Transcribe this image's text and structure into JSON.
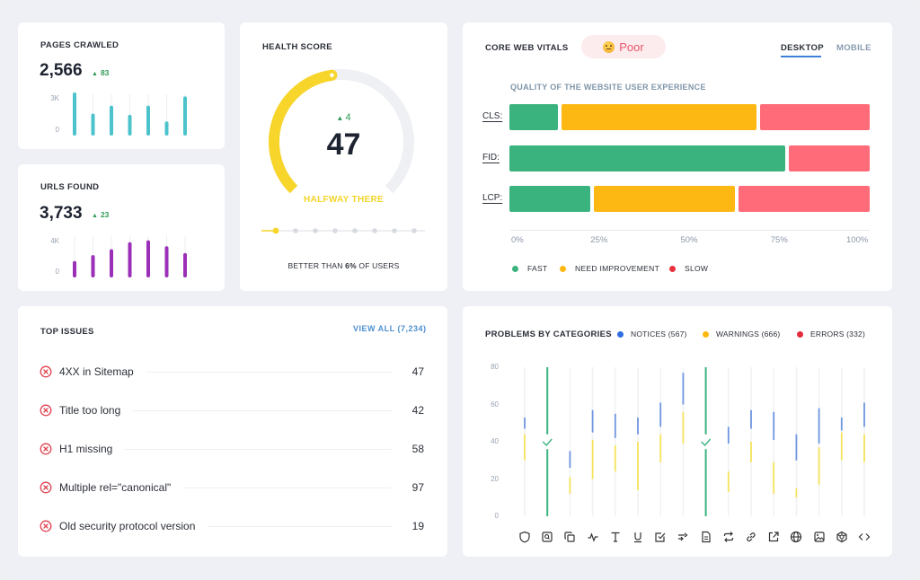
{
  "pages_crawled": {
    "title": "PAGES CRAWLED",
    "value": "2,566",
    "delta": "83",
    "y_labels": [
      "3K",
      "0"
    ],
    "chart_data": {
      "type": "bar",
      "series": [
        {
          "name": "pages",
          "values": [
            3000,
            1400,
            2000,
            1300,
            2000,
            800,
            2700
          ]
        }
      ],
      "ylim": [
        0,
        3000
      ]
    },
    "color": "#4cc2cc"
  },
  "urls_found": {
    "title": "URLS FOUND",
    "value": "3,733",
    "delta": "23",
    "y_labels": [
      "4K",
      "0"
    ],
    "chart_data": {
      "type": "bar",
      "series": [
        {
          "name": "urls",
          "values": [
            1300,
            1900,
            2500,
            3200,
            3400,
            2800,
            2100
          ]
        }
      ],
      "ylim": [
        0,
        4000
      ]
    },
    "color": "#9b2fb8"
  },
  "health": {
    "title": "HEALTH SCORE",
    "delta": "4",
    "score": 47,
    "score_label": "47",
    "status": "HALFWAY THERE",
    "better_prefix": "BETTER THAN ",
    "better_pct": "6%",
    "better_suffix": " OF USERS",
    "progress_steps": 8,
    "progress_current": 1,
    "accent": "#f7d52a"
  },
  "cwv": {
    "title": "CORE WEB VITALS",
    "badge": "Poor",
    "tabs": [
      {
        "label": "DESKTOP",
        "active": true
      },
      {
        "label": "MOBILE",
        "active": false
      }
    ],
    "subtitle": "QUALITY OF THE WEBSITE USER EXPERIENCE",
    "chart_data": {
      "type": "bar",
      "orientation": "horizontal-stacked",
      "categories": [
        "CLS:",
        "FID:",
        "LCP:"
      ],
      "series": [
        {
          "name": "FAST",
          "values": [
            14,
            77,
            23
          ],
          "color": "#3bb37f"
        },
        {
          "name": "NEED IMPROVEMENT",
          "values": [
            55,
            0,
            40
          ],
          "color": "#fdb813"
        },
        {
          "name": "SLOW",
          "values": [
            31,
            23,
            37
          ],
          "color": "#ff6b78"
        }
      ],
      "xticks": [
        "0%",
        "25%",
        "50%",
        "75%",
        "100%"
      ],
      "xlim": [
        0,
        100
      ]
    },
    "legend": [
      {
        "label": "FAST",
        "color": "#3bb37f"
      },
      {
        "label": "NEED IMPROVEMENT",
        "color": "#fdb813"
      },
      {
        "label": "SLOW",
        "color": "#e8323f"
      }
    ]
  },
  "top_issues": {
    "title": "TOP ISSUES",
    "view_all": "VIEW ALL (7,234)",
    "items": [
      {
        "label": "4XX in Sitemap",
        "count": "47"
      },
      {
        "label": "Title too long",
        "count": "42"
      },
      {
        "label": "H1 missing",
        "count": "58"
      },
      {
        "label": "Multiple rel=\"canonical\"",
        "count": "97"
      },
      {
        "label": "Old security protocol version",
        "count": "19"
      }
    ]
  },
  "problems": {
    "title": "PROBLEMS BY CATEGORIES",
    "legend": [
      {
        "label": "NOTICES (567)",
        "color": "#2f6de0"
      },
      {
        "label": "WARNINGS (666)",
        "color": "#fdb813"
      },
      {
        "label": "ERRORS (332)",
        "color": "#e32c3a"
      }
    ],
    "y_labels": [
      "80",
      "60",
      "40",
      "20",
      "0"
    ],
    "chart_data": {
      "type": "bar",
      "orientation": "vertical-ranges",
      "ylim": [
        0,
        80
      ],
      "categories": [
        "security",
        "indexability",
        "duplicates",
        "performance",
        "text",
        "underline",
        "validation",
        "redirect-chain",
        "content",
        "redirects",
        "links",
        "external-links",
        "international",
        "images",
        "structured-data",
        "code"
      ],
      "series": [
        {
          "name": "notices",
          "ranges": [
            [
              47,
              53
            ],
            null,
            [
              26,
              35
            ],
            [
              45,
              57
            ],
            [
              42,
              55
            ],
            [
              44,
              53
            ],
            [
              48,
              61
            ],
            [
              60,
              77
            ],
            null,
            [
              39,
              48
            ],
            [
              47,
              57
            ],
            [
              41,
              56
            ],
            [
              30,
              44
            ],
            [
              39,
              58
            ],
            [
              46,
              53
            ],
            [
              48,
              61
            ]
          ]
        },
        {
          "name": "warnings",
          "ranges": [
            [
              30,
              44
            ],
            null,
            [
              12,
              21
            ],
            [
              20,
              41
            ],
            [
              24,
              38
            ],
            [
              14,
              40
            ],
            [
              29,
              44
            ],
            [
              39,
              56
            ],
            null,
            [
              13,
              24
            ],
            [
              29,
              40
            ],
            [
              12,
              29
            ],
            [
              10,
              15
            ],
            [
              17,
              37
            ],
            [
              30,
              45
            ],
            [
              29,
              44
            ]
          ]
        },
        {
          "name": "ok",
          "ranges": [
            null,
            [
              0,
              80
            ],
            null,
            null,
            null,
            null,
            null,
            null,
            [
              0,
              80
            ],
            null,
            null,
            null,
            null,
            null,
            null,
            null
          ]
        }
      ]
    },
    "icons": [
      "shield-icon",
      "search-page-icon",
      "copy-icon",
      "pulse-icon",
      "text-icon",
      "underline-icon",
      "checkbox-icon",
      "redirect-chain-icon",
      "document-icon",
      "repeat-icon",
      "link-icon",
      "external-link-icon",
      "globe-icon",
      "image-icon",
      "structure-icon",
      "code-icon"
    ]
  }
}
